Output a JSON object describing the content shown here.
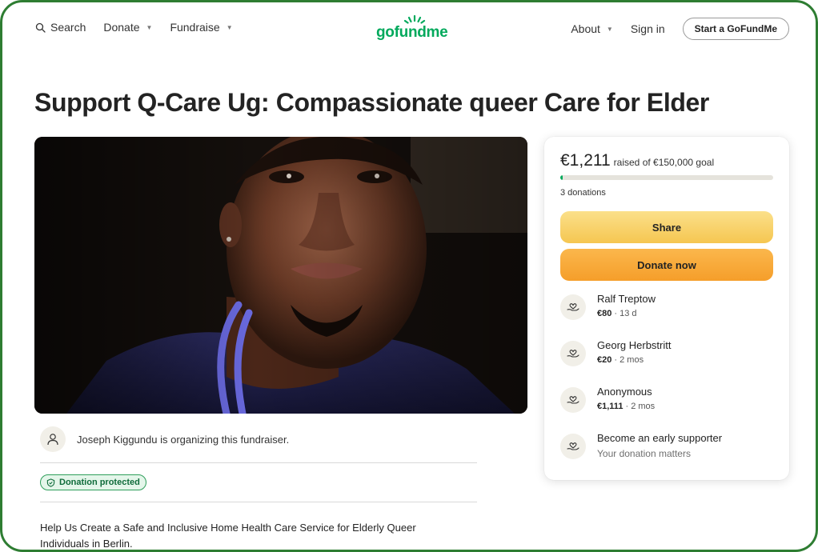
{
  "header": {
    "search_label": "Search",
    "donate_label": "Donate",
    "fundraise_label": "Fundraise",
    "logo_text": "gofundme",
    "about_label": "About",
    "signin_label": "Sign in",
    "start_label": "Start a GoFundMe"
  },
  "page": {
    "title": "Support Q-Care Ug: Compassionate queer Care for Elder"
  },
  "organizer": {
    "text": "Joseph Kiggundu is organizing this fundraiser."
  },
  "badge": {
    "label": "Donation protected"
  },
  "story": {
    "text": "Help Us Create a Safe and Inclusive Home Health Care Service for Elderly Queer Individuals in Berlin."
  },
  "card": {
    "raised_amount": "€1,211",
    "raised_goal": "raised of €150,000 goal",
    "progress_fraction": 0.0081,
    "donations_count": "3 donations",
    "share_label": "Share",
    "donate_label": "Donate now",
    "donors": [
      {
        "name": "Ralf Treptow",
        "amount": "€80",
        "time": " · 13 d"
      },
      {
        "name": "Georg Herbstritt",
        "amount": "€20",
        "time": " · 2 mos"
      },
      {
        "name": "Anonymous",
        "amount": "€1,111",
        "time": " · 2 mos"
      }
    ],
    "early": {
      "title": "Become an early supporter",
      "subtitle": "Your donation matters"
    }
  },
  "colors": {
    "brand_green": "#02a95c",
    "share_yellow": "#f5c651",
    "donate_orange": "#f59e2a",
    "frame_green": "#2e7d32"
  },
  "icons": [
    "search-icon",
    "chevron-down-icon",
    "user-icon",
    "shield-icon",
    "heart-hand-icon"
  ]
}
